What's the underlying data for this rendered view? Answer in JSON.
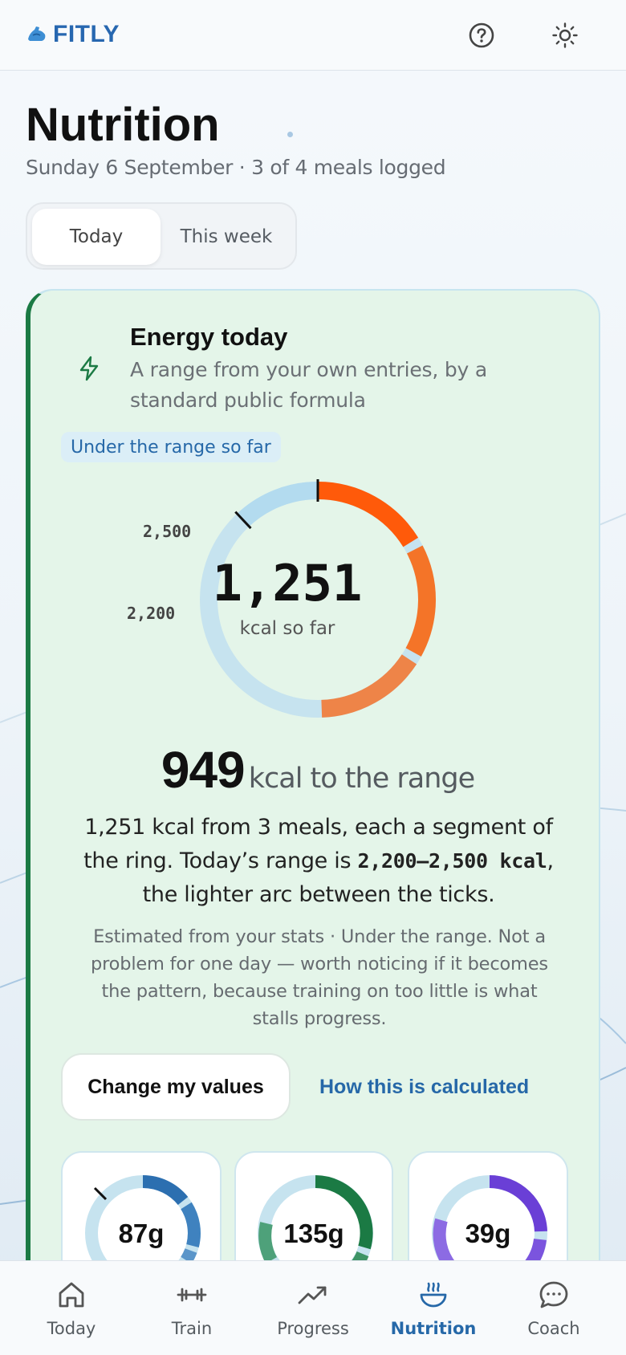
{
  "app": {
    "brand": "FITLY"
  },
  "header": {
    "help_icon": "help-circle-icon",
    "theme_icon": "sun-icon"
  },
  "page": {
    "title": "Nutrition",
    "subtitle": "Sunday 6 September · 3 of 4 meals logged"
  },
  "tabs": [
    {
      "label": "Today",
      "selected": true
    },
    {
      "label": "This week",
      "selected": false
    }
  ],
  "energy": {
    "title": "Energy today",
    "description": "A range from your own entries, by a standard public formula",
    "status": "Under the range so far",
    "value": "1,251",
    "unit": "kcal so far",
    "tick_high": "2,500",
    "tick_low": "2,200",
    "remaining_value": "949",
    "remaining_unit": "kcal to the range",
    "explain_part1": "1,251 kcal from 3 meals, each a segment of the ring. Today’s range is ",
    "explain_range": "2,200–2,500 kcal",
    "explain_part2": ", the lighter arc between the ticks.",
    "note": "Estimated from your stats · Under the range. Not a problem for one day — worth noticing if it becomes the pattern, because training on too little is what stalls progress.",
    "change_button": "Change my values",
    "how_link": "How this is calculated",
    "range_kcal": [
      2200,
      2500
    ],
    "meal_segments_kcal": [
      420,
      420,
      411
    ],
    "colors": {
      "seg1": "#ff5a0a",
      "seg2": "#f47428",
      "seg3": "#ee8448",
      "track": "#c6e3ef",
      "range_arc": "#b3dbef"
    }
  },
  "macros": [
    {
      "value": "87g",
      "color": "#2c6fb0",
      "track": "#c6e3ef"
    },
    {
      "value": "135g",
      "color": "#1b7a44",
      "track": "#c6e3ef"
    },
    {
      "value": "39g",
      "color": "#6a3fd6",
      "track": "#c6e3ef"
    }
  ],
  "nav": [
    {
      "label": "Today",
      "icon": "home-icon",
      "active": false
    },
    {
      "label": "Train",
      "icon": "dumbbell-icon",
      "active": false
    },
    {
      "label": "Progress",
      "icon": "trend-up-icon",
      "active": false
    },
    {
      "label": "Nutrition",
      "icon": "bowl-icon",
      "active": true
    },
    {
      "label": "Coach",
      "icon": "chat-icon",
      "active": false
    }
  ]
}
